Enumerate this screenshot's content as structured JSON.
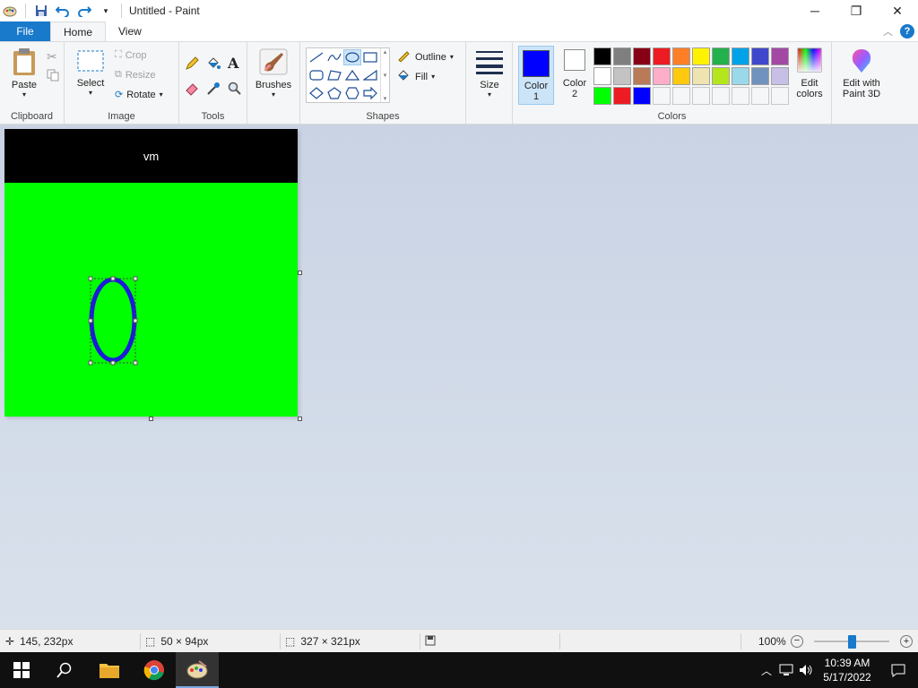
{
  "window": {
    "title": "Untitled - Paint"
  },
  "tabs": {
    "file": "File",
    "home": "Home",
    "view": "View"
  },
  "clipboard": {
    "paste": "Paste",
    "label": "Clipboard"
  },
  "image": {
    "select": "Select",
    "crop": "Crop",
    "resize": "Resize",
    "rotate": "Rotate",
    "label": "Image"
  },
  "tools": {
    "label": "Tools"
  },
  "brushes": {
    "label": "Brushes"
  },
  "shapes": {
    "outline": "Outline",
    "fill": "Fill",
    "label": "Shapes"
  },
  "size": {
    "label": "Size"
  },
  "colors": {
    "color1_line1": "Color",
    "color1_line2": "1",
    "color2_line1": "Color",
    "color2_line2": "2",
    "edit_line1": "Edit",
    "edit_line2": "colors",
    "label": "Colors",
    "color1_value": "#0000ff",
    "color2_value": "#ffffff",
    "palette_row1": [
      "#000000",
      "#7f7f7f",
      "#880015",
      "#ed1c24",
      "#ff7f27",
      "#fff200",
      "#22b14c",
      "#00a2e8",
      "#3f48cc",
      "#a349a4"
    ],
    "palette_row2": [
      "#ffffff",
      "#c3c3c3",
      "#b97a57",
      "#ffaec9",
      "#ffc90e",
      "#efe4b0",
      "#b5e61d",
      "#99d9ea",
      "#7092be",
      "#c8bfe7"
    ],
    "palette_row3": [
      "#00ff00",
      "#ed1c24",
      "#0000ff",
      "",
      "",
      "",
      "",
      "",
      "",
      ""
    ]
  },
  "paint3d": {
    "line1": "Edit with",
    "line2": "Paint 3D"
  },
  "canvas": {
    "header_text": "vm",
    "background": "#00ff00",
    "header_color": "#000000",
    "ellipse_color": "#1c1cd8"
  },
  "status": {
    "cursor_pos": "145, 232px",
    "selection_size": "50 × 94px",
    "image_size": "327 × 321px",
    "zoom": "100%"
  },
  "taskbar": {
    "time": "10:39 AM",
    "date": "5/17/2022"
  }
}
